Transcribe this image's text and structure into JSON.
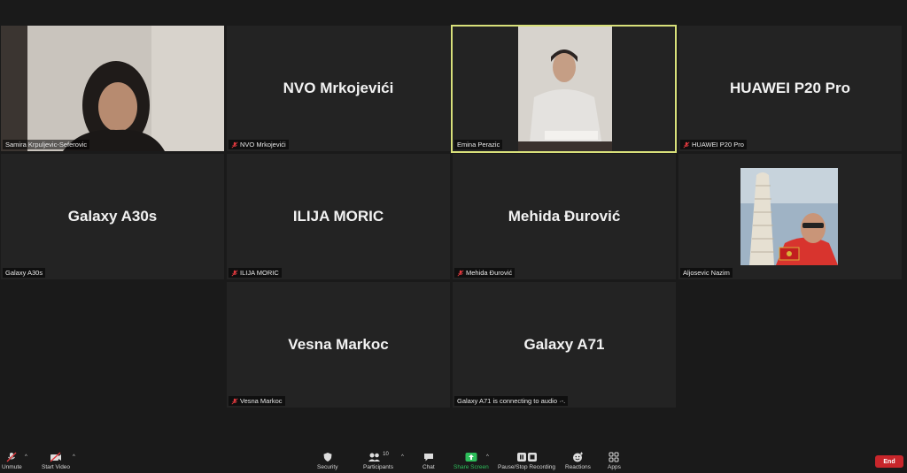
{
  "participants": [
    {
      "tile_name": "",
      "tag": "Samira Krpuljevic-Seferovic",
      "muted": false
    },
    {
      "tile_name": "NVO Mrkojevići",
      "tag": "NVO Mrkojevići",
      "muted": true
    },
    {
      "tile_name": "",
      "tag": "Emina Perazic",
      "muted": false
    },
    {
      "tile_name": "HUAWEI P20 Pro",
      "tag": "HUAWEI P20 Pro",
      "muted": true
    },
    {
      "tile_name": "Galaxy A30s",
      "tag": "Galaxy A30s",
      "muted": false
    },
    {
      "tile_name": "ILIJA MORIC",
      "tag": "ILIJA MORIC",
      "muted": true
    },
    {
      "tile_name": "Mehida Đurović",
      "tag": "Mehida Đurović",
      "muted": true
    },
    {
      "tile_name": "",
      "tag": "Aljosevic Nazim",
      "muted": false
    },
    {
      "tile_name": "Vesna Markoc",
      "tag": "Vesna Markoc",
      "muted": true
    },
    {
      "tile_name": "Galaxy A71",
      "tag": "Galaxy A71 is connecting to audio ·-.",
      "muted": false
    }
  ],
  "toolbar": {
    "unmute": "Unmute",
    "start_video": "Start Video",
    "security": "Security",
    "participants": "Participants",
    "participants_count": "10",
    "chat": "Chat",
    "share_screen": "Share Screen",
    "recording": "Pause/Stop Recording",
    "reactions": "Reactions",
    "apps": "Apps",
    "end": "End"
  },
  "colors": {
    "background": "#1a1a1a",
    "tile": "#232323",
    "active_speaker_border": "#d8e07a",
    "share_green": "#2dbd5a",
    "end_red": "#c8262b",
    "mute_red": "#e0393e"
  },
  "icons": [
    "mic-muted-icon",
    "video-off-icon",
    "shield-icon",
    "participants-icon",
    "chat-icon",
    "share-screen-icon",
    "record-pause-icon",
    "reactions-icon",
    "apps-icon"
  ]
}
